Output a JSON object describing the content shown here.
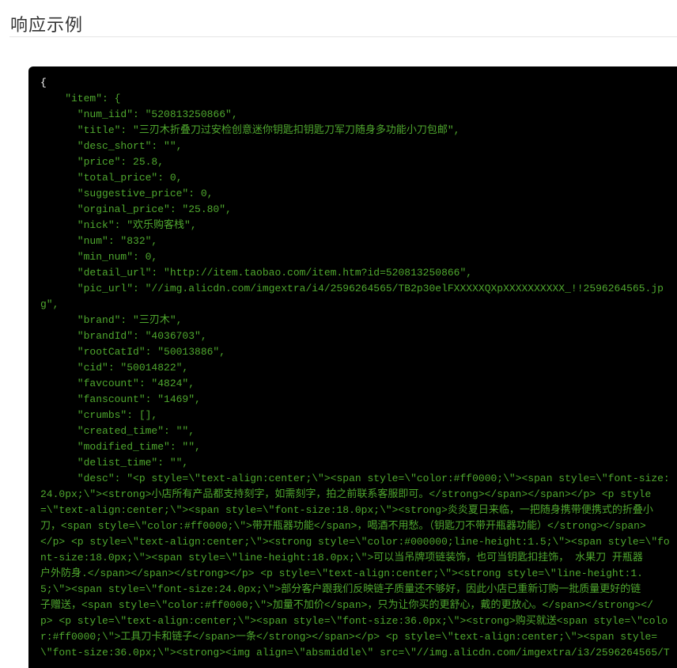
{
  "section_title": "响应示例",
  "colors": {
    "background": "#000000",
    "string": "#4fa82e",
    "number": "#3a8fe8",
    "punctuation": "#ffffff"
  },
  "code_lines": [
    {
      "t": "{"
    },
    {
      "t": "    \"item\": {"
    },
    {
      "t": "      \"num_iid\": \"520813250866\","
    },
    {
      "t": "      \"title\": \"三刃木折叠刀过安检创意迷你钥匙扣钥匙刀军刀随身多功能小刀包邮\","
    },
    {
      "t": "      \"desc_short\": \"\","
    },
    {
      "t": "      \"price\": 25.8,"
    },
    {
      "t": "      \"total_price\": 0,"
    },
    {
      "t": "      \"suggestive_price\": 0,"
    },
    {
      "t": "      \"orginal_price\": \"25.80\","
    },
    {
      "t": "      \"nick\": \"欢乐购客栈\","
    },
    {
      "t": "      \"num\": \"832\","
    },
    {
      "t": "      \"min_num\": 0,"
    },
    {
      "t": "      \"detail_url\": \"http://item.taobao.com/item.htm?id=520813250866\","
    },
    {
      "t": "      \"pic_url\": \"//img.alicdn.com/imgextra/i4/2596264565/TB2p30elFXXXXXQXpXXXXXXXXXX_!!2596264565.jp"
    },
    {
      "t": "g\",",
      "cont": true
    },
    {
      "t": "      \"brand\": \"三刃木\","
    },
    {
      "t": "      \"brandId\": \"4036703\","
    },
    {
      "t": "      \"rootCatId\": \"50013886\","
    },
    {
      "t": "      \"cid\": \"50014822\","
    },
    {
      "t": "      \"favcount\": \"4824\","
    },
    {
      "t": "      \"fanscount\": \"1469\","
    },
    {
      "t": "      \"crumbs\": [],"
    },
    {
      "t": "      \"created_time\": \"\","
    },
    {
      "t": "      \"modified_time\": \"\","
    },
    {
      "t": "      \"delist_time\": \"\","
    },
    {
      "t": "      \"desc\": \"<p style=\\\"text-align:center;\\\"><span style=\\\"color:#ff0000;\\\"><span style=\\\"font-size:"
    },
    {
      "t": "24.0px;\\\"><strong>小店所有产品都支持刻字，如需刻字，拍之前联系客服即可。</strong></span></span></p> <p style",
      "cont": true
    },
    {
      "t": "=\\\"text-align:center;\\\"><span style=\\\"font-size:18.0px;\\\"><strong>炎炎夏日来临，一把随身携带便携式的折叠小",
      "cont": true
    },
    {
      "t": "刀，<span style=\\\"color:#ff0000;\\\">带开瓶器功能</span>，喝酒不用愁。（钥匙刀不带开瓶器功能）</strong></span>",
      "cont": true
    },
    {
      "t": "</p> <p style=\\\"text-align:center;\\\"><strong style=\\\"color:#000000;line-height:1.5;\\\"><span style=\\\"fo",
      "cont": true
    },
    {
      "t": "nt-size:18.0px;\\\"><span style=\\\"line-height:18.0px;\\\">可以当吊牌项链装饰，也可当钥匙扣挂饰， 水果刀 开瓶器",
      "cont": true
    },
    {
      "t": "户外防身.</span></span></strong></p> <p style=\\\"text-align:center;\\\"><strong style=\\\"line-height:1.",
      "cont": true
    },
    {
      "t": "5;\\\"><span style=\\\"font-size:24.0px;\\\">部分客户跟我们反映链子质量还不够好，因此小店已重新订购一批质量更好的链",
      "cont": true
    },
    {
      "t": "子赠送，<span style=\\\"color:#ff0000;\\\">加量不加价</span>，只为让你买的更舒心，戴的更放心。</span></strong></",
      "cont": true
    },
    {
      "t": "p> <p style=\\\"text-align:center;\\\"><span style=\\\"font-size:36.0px;\\\"><strong>购买就送<span style=\\\"colo",
      "cont": true
    },
    {
      "t": "r:#ff0000;\\\">工具刀卡和链子</span>一条</strong></span></p> <p style=\\\"text-align:center;\\\"><span style=",
      "cont": true
    },
    {
      "t": "\\\"font-size:36.0px;\\\"><strong><img align=\\\"absmiddle\\\" src=\\\"//img.alicdn.com/imgextra/i3/2596264565/T",
      "cont": true
    }
  ]
}
